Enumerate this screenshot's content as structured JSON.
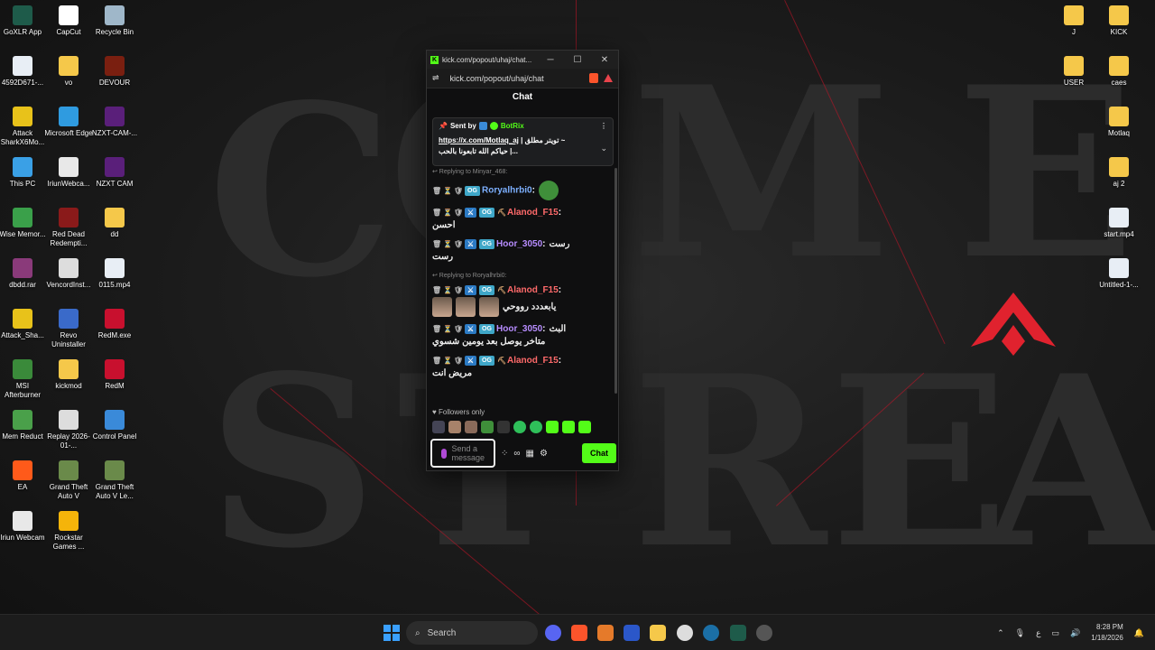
{
  "desktop": {
    "left_icons": [
      {
        "label": "GoXLR App",
        "icon": "goxlr-icon",
        "color": "#1e5b4a"
      },
      {
        "label": "CapCut",
        "icon": "capcut-icon",
        "color": "#ffffff"
      },
      {
        "label": "Recycle Bin",
        "icon": "recycle-bin-icon",
        "color": "#9fb7c9"
      },
      {
        "label": "4592D671-...",
        "icon": "file-icon",
        "color": "#e8eef5"
      },
      {
        "label": "vo",
        "icon": "folder-icon",
        "color": "#f5c84a"
      },
      {
        "label": "DEVOUR",
        "icon": "devour-icon",
        "color": "#7a1f10"
      },
      {
        "label": "Attack SharkX6Mo...",
        "icon": "attack-shark-icon",
        "color": "#e8c21a"
      },
      {
        "label": "Microsoft Edge",
        "icon": "edge-icon",
        "color": "#2f9be0"
      },
      {
        "label": "NZXT-CAM-...",
        "icon": "nzxt-icon",
        "color": "#5a1f7a"
      },
      {
        "label": "This PC",
        "icon": "this-pc-icon",
        "color": "#3aa0e6"
      },
      {
        "label": "IriunWebca...",
        "icon": "iriun-icon",
        "color": "#e8e8e8"
      },
      {
        "label": "NZXT CAM",
        "icon": "nzxt-cam-icon",
        "color": "#5a1f7a"
      },
      {
        "label": "Wise Memor...",
        "icon": "wise-memory-icon",
        "color": "#3aa04a"
      },
      {
        "label": "Red Dead Redempti...",
        "icon": "red-dead-icon",
        "color": "#8a1a1a"
      },
      {
        "label": "dd",
        "icon": "folder-icon",
        "color": "#f5c84a"
      },
      {
        "label": "dbdd.rar",
        "icon": "rar-icon",
        "color": "#8a3a7a"
      },
      {
        "label": "VencordInst...",
        "icon": "vencord-icon",
        "color": "#dddddd"
      },
      {
        "label": "0115.mp4",
        "icon": "video-file-icon",
        "color": "#e8eef5"
      },
      {
        "label": "Attack_Sha...",
        "icon": "attack-shark-icon",
        "color": "#e8c21a"
      },
      {
        "label": "Revo Uninstaller",
        "icon": "revo-icon",
        "color": "#3a6ac9"
      },
      {
        "label": "RedM.exe",
        "icon": "redm-icon",
        "color": "#c8102e"
      },
      {
        "label": "MSI Afterburner",
        "icon": "msi-afterburner-icon",
        "color": "#3a8a3a"
      },
      {
        "label": "kickmod",
        "icon": "folder-icon",
        "color": "#f5c84a"
      },
      {
        "label": "RedM",
        "icon": "redm-icon",
        "color": "#c8102e"
      },
      {
        "label": "Mem Reduct",
        "icon": "mem-reduct-icon",
        "color": "#4aa04a"
      },
      {
        "label": "Replay 2026-01-...",
        "icon": "replay-icon",
        "color": "#dddddd"
      },
      {
        "label": "Control Panel",
        "icon": "control-panel-icon",
        "color": "#3a8ad9"
      },
      {
        "label": "EA",
        "icon": "ea-icon",
        "color": "#ff5a1a"
      },
      {
        "label": "Grand Theft Auto V",
        "icon": "gta-icon",
        "color": "#6a8a4a"
      },
      {
        "label": "Grand Theft Auto V Le...",
        "icon": "gta-icon",
        "color": "#6a8a4a"
      },
      {
        "label": "Iriun Webcam",
        "icon": "iriun-icon",
        "color": "#e8e8e8"
      },
      {
        "label": "Rockstar Games ...",
        "icon": "rockstar-icon",
        "color": "#f5b40a"
      }
    ],
    "right_icons": [
      {
        "label": "J",
        "icon": "folder-icon",
        "color": "#f5c84a"
      },
      {
        "label": "KICK",
        "icon": "folder-icon",
        "color": "#f5c84a"
      },
      {
        "label": "USER",
        "icon": "folder-icon",
        "color": "#f5c84a"
      },
      {
        "label": "caes",
        "icon": "folder-icon",
        "color": "#f5c84a"
      },
      {
        "label": "Motlaq",
        "icon": "folder-icon",
        "color": "#f5c84a"
      },
      {
        "label": "aj 2",
        "icon": "folder-icon",
        "color": "#f5c84a"
      },
      {
        "label": "start.mp4",
        "icon": "video-file-icon",
        "color": "#e8eef5"
      },
      {
        "label": "Untitled-1-...",
        "icon": "video-file-icon",
        "color": "#e8eef5"
      }
    ],
    "hidden_partial_labels": [
      "am",
      "d-1-..."
    ],
    "wallpaper_letters": [
      "C",
      "O",
      "M",
      "E",
      "S",
      "T",
      "R",
      "E",
      "A"
    ]
  },
  "window": {
    "title": "kick.com/popout/uhaj/chat...",
    "url": "kick.com/popout/uhaj/chat",
    "favicon": "K",
    "controls": {
      "minimize": "─",
      "maximize": "☐",
      "close": "✕"
    }
  },
  "chat": {
    "header": "Chat",
    "pinned": {
      "sent_by_label": "Sent by",
      "bot_name": "BotRix",
      "link": "https://x.com/Motlaq_aj",
      "text_line1": "| تويتر مطلق ~",
      "text_line2": "حياكم الله تابعونا بالحب |...",
      "menu": "⋮",
      "chevron": "⌄",
      "pin": "📌"
    },
    "messages": [
      {
        "reply": "↩ Replying to Minyar_468:",
        "user": "Roryalhrbi0",
        "color_class": "user-blue",
        "badges": [
          "🗑",
          "⏳",
          "🛡",
          "OG"
        ],
        "content": "",
        "emotes": [
          "frog"
        ]
      },
      {
        "reply": "",
        "user": "Alanod_F15",
        "color_class": "user-red",
        "badges": [
          "🗑",
          "⏳",
          "🛡",
          "⚔",
          "OG",
          "⛏"
        ],
        "content": "احسن",
        "emotes": []
      },
      {
        "reply": "",
        "user": "Hoor_3050",
        "color_class": "user-purple",
        "badges": [
          "🗑",
          "⏳",
          "🛡",
          "⚔",
          "OG"
        ],
        "content": "رست",
        "prefix": "رست",
        "emotes": []
      },
      {
        "reply": "↩ Replying to Roryalhrbi0:",
        "user": "Alanod_F15",
        "color_class": "user-red",
        "badges": [
          "🗑",
          "⏳",
          "🛡",
          "⚔",
          "OG",
          "⛏"
        ],
        "content": "يابعددد رووحي",
        "emotes": [
          "face",
          "face",
          "face"
        ]
      },
      {
        "reply": "",
        "user": "Hoor_3050",
        "color_class": "user-purple",
        "badges": [
          "🗑",
          "⏳",
          "🛡",
          "⚔",
          "OG"
        ],
        "content": "متاخر يوصل بعد يومين شسوي",
        "prefix": "البث",
        "emotes": []
      },
      {
        "reply": "",
        "user": "Alanod_F15",
        "color_class": "user-red",
        "badges": [
          "🗑",
          "⏳",
          "🛡",
          "⚔",
          "OG",
          "⛏"
        ],
        "content": "مريض انت",
        "emotes": []
      }
    ],
    "followers_only": "Followers only",
    "input_placeholder": "Send a message",
    "send_button": "Chat"
  },
  "taskbar": {
    "search_label": "Search",
    "time": "8:28 PM",
    "date": "1/18/2026",
    "lang": "ع"
  }
}
